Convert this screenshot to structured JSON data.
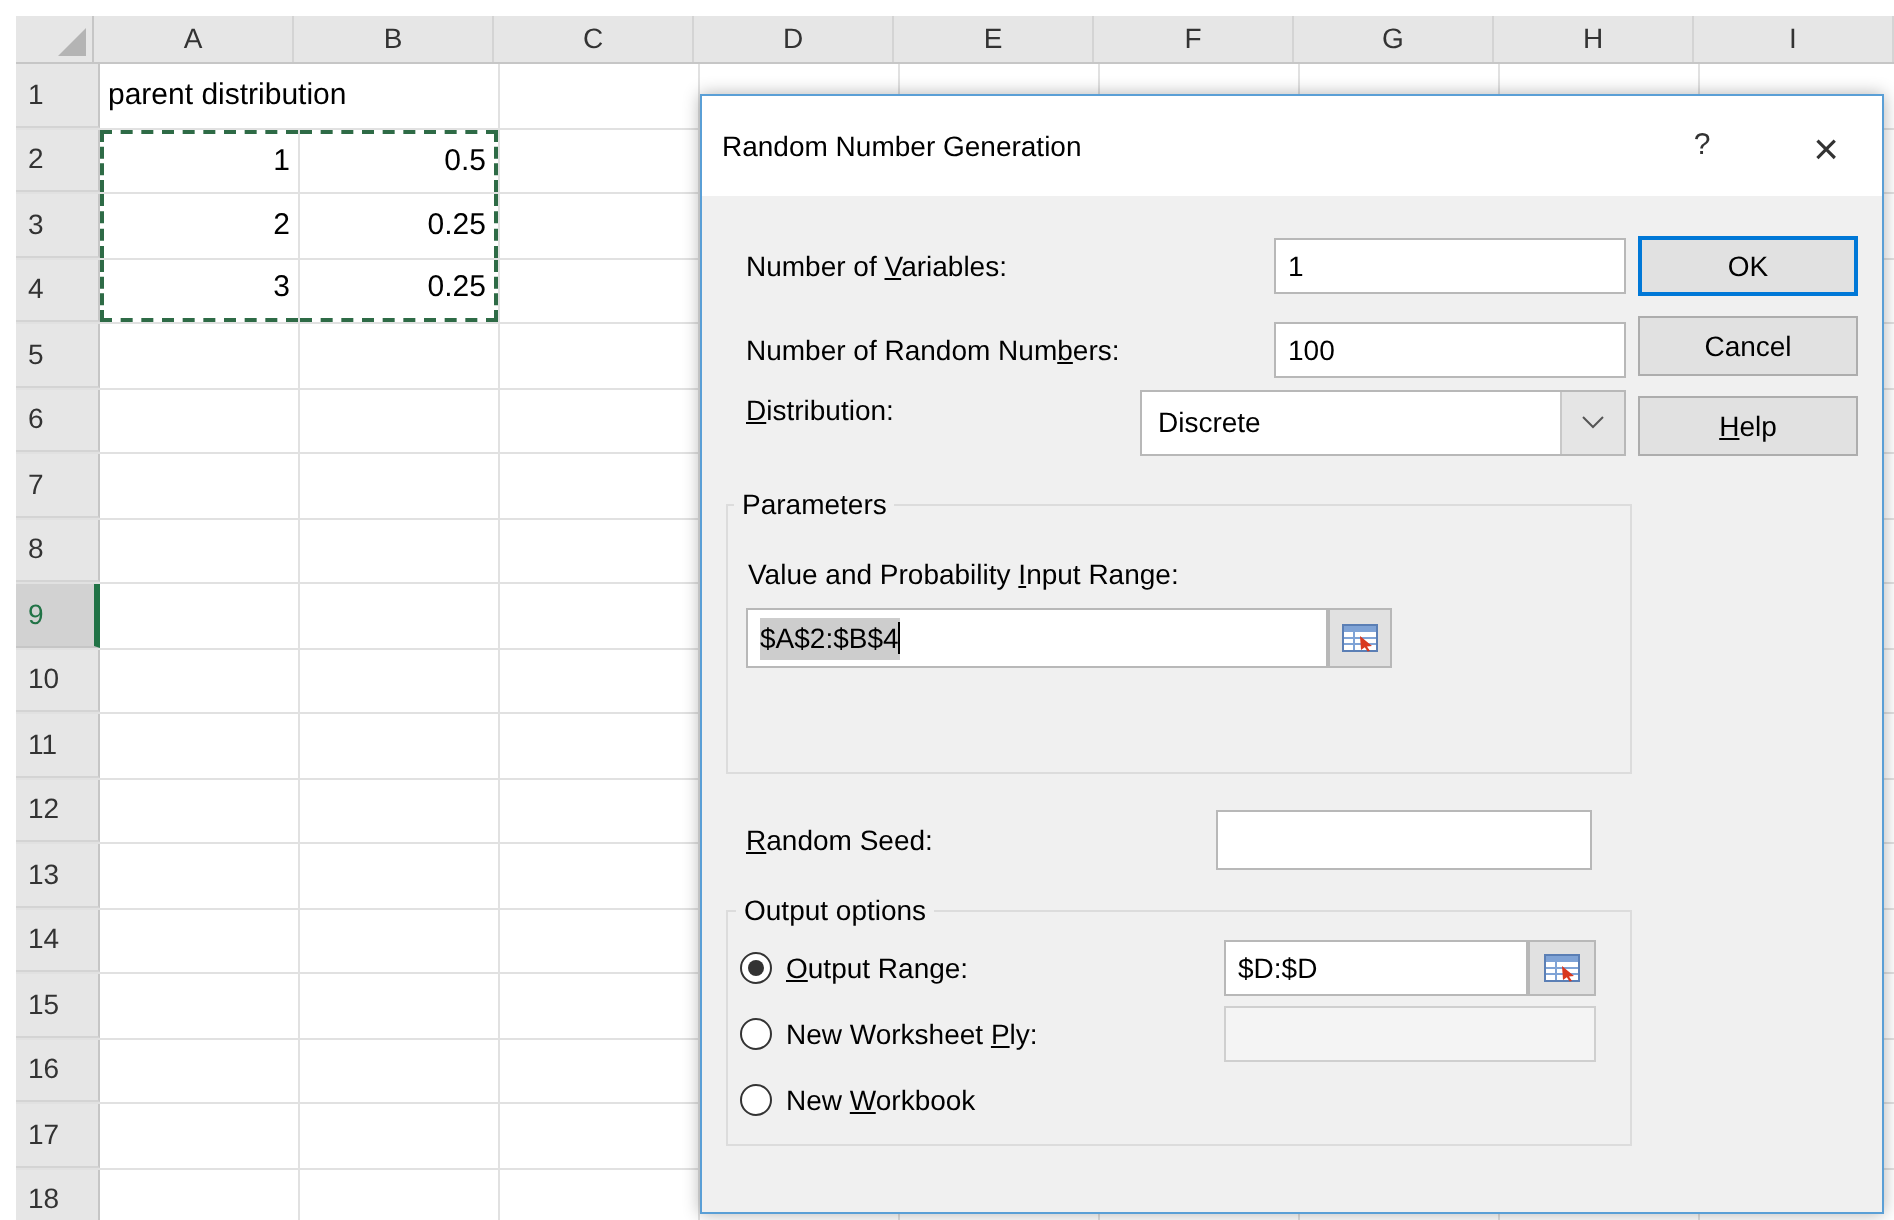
{
  "sheet": {
    "columns": [
      {
        "label": "A"
      },
      {
        "label": "B"
      },
      {
        "label": "C"
      },
      {
        "label": "D"
      },
      {
        "label": "E"
      },
      {
        "label": "F"
      },
      {
        "label": "G"
      },
      {
        "label": "H"
      },
      {
        "label": "I"
      }
    ],
    "rows": [
      {
        "label": "1",
        "selected": false,
        "cells": [
          {
            "value": "parent distribution",
            "overflow": true,
            "copied": false
          }
        ]
      },
      {
        "label": "2",
        "selected": false,
        "cells": [
          {
            "value": "1",
            "overflow": false,
            "copied": true
          },
          {
            "value": "0.5",
            "overflow": false,
            "copied": true
          }
        ]
      },
      {
        "label": "3",
        "selected": false,
        "cells": [
          {
            "value": "2",
            "overflow": false,
            "copied": true
          },
          {
            "value": "0.25",
            "overflow": false,
            "copied": true
          }
        ]
      },
      {
        "label": "4",
        "selected": false,
        "cells": [
          {
            "value": "3",
            "overflow": false,
            "copied": true
          },
          {
            "value": "0.25",
            "overflow": false,
            "copied": true
          }
        ]
      },
      {
        "label": "5",
        "selected": false
      },
      {
        "label": "6",
        "selected": false
      },
      {
        "label": "7",
        "selected": false
      },
      {
        "label": "8",
        "selected": false
      },
      {
        "label": "9",
        "selected": true
      },
      {
        "label": "10",
        "selected": false
      },
      {
        "label": "11",
        "selected": false
      },
      {
        "label": "12",
        "selected": false
      },
      {
        "label": "13",
        "selected": false
      },
      {
        "label": "14",
        "selected": false
      },
      {
        "label": "15",
        "selected": false
      },
      {
        "label": "16",
        "selected": false
      },
      {
        "label": "17",
        "selected": false
      },
      {
        "label": "18",
        "selected": false
      }
    ]
  },
  "dialog": {
    "title": "Random Number Generation",
    "help_glyph": "?",
    "close_glyph": "×",
    "variables": {
      "label": {
        "pre": "Number of ",
        "key": "V",
        "post": "ariables:"
      },
      "value": "1"
    },
    "random_numbers": {
      "label": {
        "pre": "Number of Random Num",
        "key": "b",
        "post": "ers:"
      },
      "value": "100"
    },
    "distribution": {
      "label": {
        "key": "D",
        "post": "istribution:"
      },
      "value": "Discrete"
    },
    "parameters": {
      "title": "Parameters",
      "label": {
        "pre": "Value and Probability ",
        "key": "I",
        "post": "nput Range:"
      },
      "value": "$A$2:$B$4",
      "text_selected": true
    },
    "random_seed": {
      "label": {
        "key": "R",
        "post": "andom Seed:"
      },
      "disabled": false
    },
    "output": {
      "title": "Output options",
      "options": [
        {
          "label": {
            "key": "O",
            "post": "utput Range:"
          },
          "selected": true,
          "field": {
            "value": "$D:$D",
            "disabled": false,
            "picker": true
          }
        },
        {
          "label": {
            "pre": "New Worksheet ",
            "key": "P",
            "post": "ly:"
          },
          "selected": false,
          "field": {
            "disabled": true,
            "picker": false
          }
        },
        {
          "label": {
            "pre": "New ",
            "key": "W",
            "post": "orkbook"
          },
          "selected": false
        }
      ]
    },
    "buttons": [
      {
        "label": {
          "post": "OK"
        },
        "default": true
      },
      {
        "label": {
          "post": "Cancel"
        },
        "default": false
      },
      {
        "label": {
          "key": "H",
          "post": "elp"
        },
        "default": false
      }
    ]
  }
}
